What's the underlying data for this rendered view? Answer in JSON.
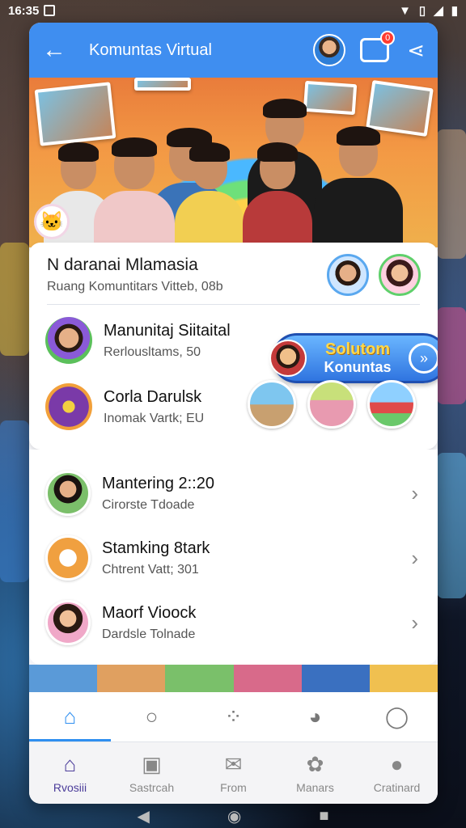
{
  "status_bar": {
    "time": "16:35"
  },
  "app_bar": {
    "title": "Komuntas Virtual",
    "notification_count": "0"
  },
  "group": {
    "title": "N daranai Mlamasia",
    "subtitle": "Ruang Komuntitars Vitteb, 08b"
  },
  "members": [
    {
      "name": "Manunitaj Siitaital",
      "detail": "Rerlousltams, 50"
    },
    {
      "name": "Corla Darulsk",
      "detail": "Inomak Vartk; EU"
    }
  ],
  "join_button": {
    "line1": "Solutom",
    "line2": "Konuntas"
  },
  "list": [
    {
      "name": "Mantering 2::20",
      "detail": "Cirorste Tdoade"
    },
    {
      "name": "Stamking 8tark",
      "detail": "Chtrent Vatt; 301"
    },
    {
      "name": "Maorf Vioock",
      "detail": "Dardsle Tolnade"
    }
  ],
  "bottom_tabs": [
    {
      "label": "Rvosiii",
      "icon": "home-icon"
    },
    {
      "label": "Sastrcah",
      "icon": "calendar-icon"
    },
    {
      "label": "From",
      "icon": "mail-icon"
    },
    {
      "label": "Manars",
      "icon": "puzzle-icon"
    },
    {
      "label": "Cratinard",
      "icon": "profile-icon"
    }
  ],
  "colors": {
    "accent": "#3f8ef0",
    "active_tab": "#4b3c9a"
  }
}
